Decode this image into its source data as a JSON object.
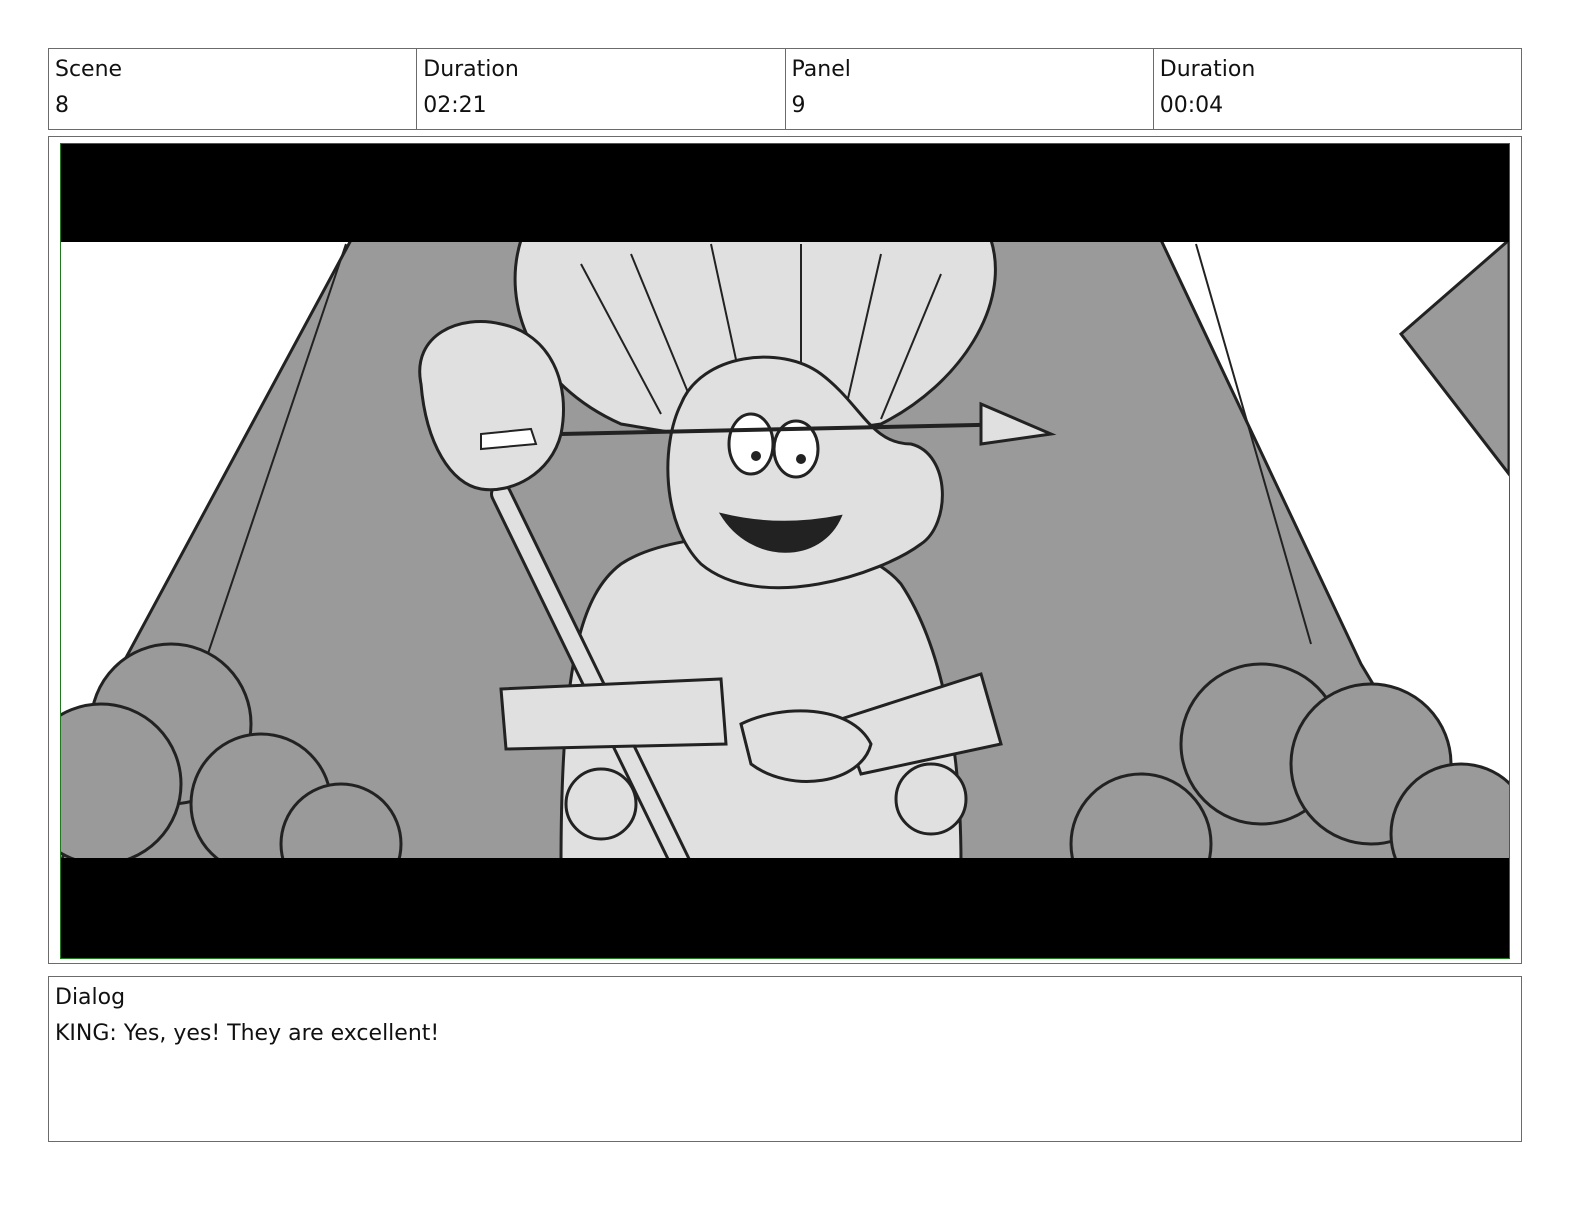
{
  "header": {
    "scene_label": "Scene",
    "scene_value": "8",
    "scene_duration_label": "Duration",
    "scene_duration_value": "02:21",
    "panel_label": "Panel",
    "panel_value": "9",
    "panel_duration_label": "Duration",
    "panel_duration_value": "00:04"
  },
  "dialog": {
    "label": "Dialog",
    "text": "KING: Yes, yes! They are excellent!"
  },
  "colors": {
    "border": "#6b6b6b",
    "frame_border": "#1f7a1f",
    "letterbox": "#000000",
    "background_gray": "#9a9a9a",
    "figure_gray": "#e0e0e0"
  }
}
